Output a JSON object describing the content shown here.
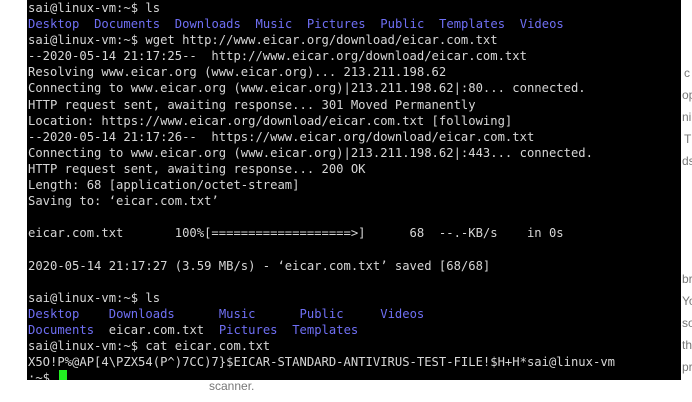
{
  "terminal": {
    "lines": [
      "sai@linux-vm:~$ ls",
      "",
      "sai@linux-vm:~$ wget http://www.eicar.org/download/eicar.com.txt",
      "--2020-05-14 21:17:25--  http://www.eicar.org/download/eicar.com.txt",
      "Resolving www.eicar.org (www.eicar.org)... 213.211.198.62",
      "Connecting to www.eicar.org (www.eicar.org)|213.211.198.62|:80... connected.",
      "HTTP request sent, awaiting response... 301 Moved Permanently",
      "Location: https://www.eicar.org/download/eicar.com.txt [following]",
      "--2020-05-14 21:17:26--  https://www.eicar.org/download/eicar.com.txt",
      "Connecting to www.eicar.org (www.eicar.org)|213.211.198.62|:443... connected.",
      "HTTP request sent, awaiting response... 200 OK",
      "Length: 68 [application/octet-stream]",
      "Saving to: ‘eicar.com.txt’",
      "",
      "eicar.com.txt       100%[===================>]      68  --.-KB/s    in 0s",
      "",
      "2020-05-14 21:17:27 (3.59 MB/s) - ‘eicar.com.txt’ saved [68/68]",
      "",
      "sai@linux-vm:~$ ls",
      "",
      "",
      "sai@linux-vm:~$ cat eicar.com.txt",
      "X5O!P%@AP[4\\PZX54(P^)7CC)7}$EICAR-STANDARD-ANTIVIRUS-TEST-FILE!$H+H*sai@linux-vm",
      ":~$ "
    ],
    "ls1": [
      "Desktop",
      "Documents",
      "Downloads",
      "Music",
      "Pictures",
      "Public",
      "Templates",
      "Videos"
    ],
    "ls2_row1": [
      "Desktop",
      "Downloads",
      "Music",
      "Public",
      "Videos"
    ],
    "ls2_row2_doc": "Documents",
    "ls2_row2_file": "eicar.com.txt",
    "ls2_row2_rest": [
      "Pictures",
      "Templates"
    ]
  },
  "background": {
    "fragments": [
      "c",
      "op",
      "ni",
      "T",
      "ds",
      "br",
      "Yo",
      "so",
      "th",
      "pr",
      "scanner."
    ]
  },
  "colors": {
    "terminal_bg": "#000000",
    "text": "#d6d6d6",
    "dir": "#6f6ff4",
    "cursor": "#22ee22"
  }
}
